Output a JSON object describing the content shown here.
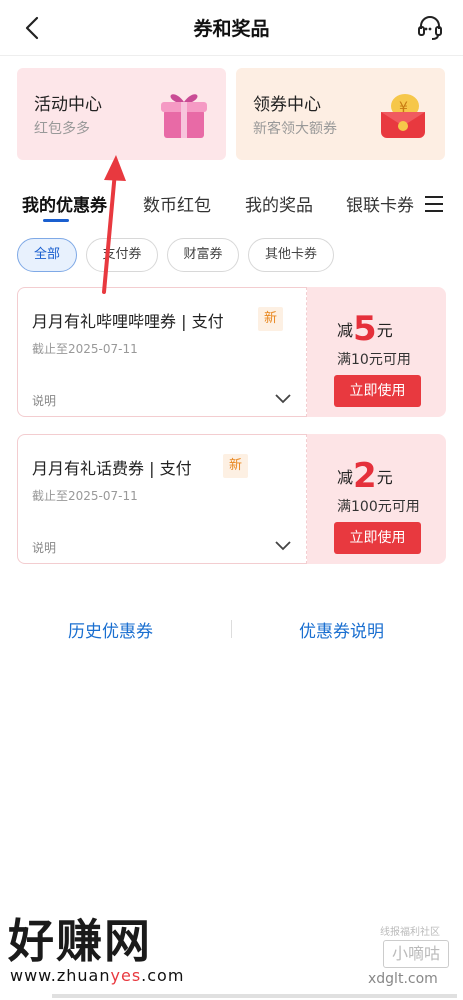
{
  "header": {
    "title": "券和奖品"
  },
  "promos": [
    {
      "title": "活动中心",
      "subtitle": "红包多多"
    },
    {
      "title": "领券中心",
      "subtitle": "新客领大额券"
    }
  ],
  "tabs": [
    {
      "label": "我的优惠券"
    },
    {
      "label": "数币红包"
    },
    {
      "label": "我的奖品"
    },
    {
      "label": "银联卡券"
    }
  ],
  "chips": [
    {
      "label": "全部"
    },
    {
      "label": "支付券"
    },
    {
      "label": "财富券"
    },
    {
      "label": "其他卡券"
    }
  ],
  "coupons": [
    {
      "name": "月月有礼哔哩哔哩券 | 支付",
      "badge": "新",
      "date": "截止至2025-07-11",
      "desc": "说明",
      "prefix": "减",
      "amount": "5",
      "unit": "元",
      "condition": "满10元可用",
      "button": "立即使用"
    },
    {
      "name": "月月有礼话费券 | 支付",
      "badge": "新",
      "date": "截止至2025-07-11",
      "desc": "说明",
      "prefix": "减",
      "amount": "2",
      "unit": "元",
      "condition": "满100元可用",
      "button": "立即使用"
    }
  ],
  "bottom": {
    "history": "历史优惠券",
    "explain": "优惠券说明"
  },
  "watermark": {
    "brand": "好赚网",
    "url_pre": "www.zhuan",
    "url_yes": "yes",
    "url_post": ".com",
    "right_top": "线报福利社区",
    "right_box": "小嘀咕",
    "right_url": "xdglt.com"
  },
  "colors": {
    "accent": "#1a5fcf",
    "coupon_red": "#e5303b",
    "badge_orange": "#e8871f"
  }
}
